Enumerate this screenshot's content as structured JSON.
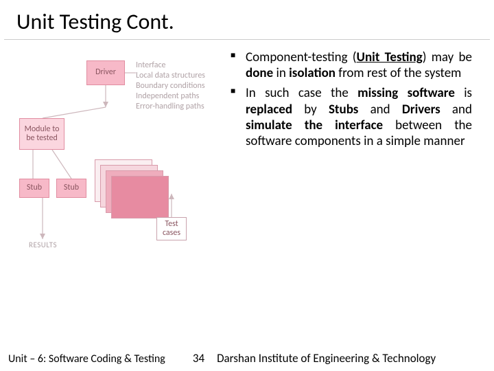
{
  "title": "Unit Testing Cont.",
  "bullets": [
    {
      "parts": [
        {
          "t": "Component-testing ("
        },
        {
          "t": "Unit Testing",
          "b": true,
          "u": true
        },
        {
          "t": ") may be "
        },
        {
          "t": "done",
          "b": true
        },
        {
          "t": " in "
        },
        {
          "t": "isolation",
          "b": true
        },
        {
          "t": " from rest of the system"
        }
      ]
    },
    {
      "parts": [
        {
          "t": "In such case the "
        },
        {
          "t": "missing software",
          "b": true
        },
        {
          "t": " is "
        },
        {
          "t": "replaced",
          "b": true
        },
        {
          "t": " by "
        },
        {
          "t": "Stubs",
          "b": true
        },
        {
          "t": " and "
        },
        {
          "t": "Drivers",
          "b": true
        },
        {
          "t": " and "
        },
        {
          "t": "simulate the interface",
          "b": true
        },
        {
          "t": " between the software components in a simple manner"
        }
      ]
    }
  ],
  "diagram": {
    "driver": "Driver",
    "module": "Module to be tested",
    "stub1": "Stub",
    "stub2": "Stub",
    "testcases": "Test cases",
    "results": "RESULTS",
    "side_list": "Interface\nLocal data structures\nBoundary conditions\nIndependent paths\nError-handling paths"
  },
  "footer": {
    "unit": "Unit – 6: Software Coding & Testing",
    "page": "34",
    "institute": "Darshan Institute of Engineering & Technology"
  }
}
